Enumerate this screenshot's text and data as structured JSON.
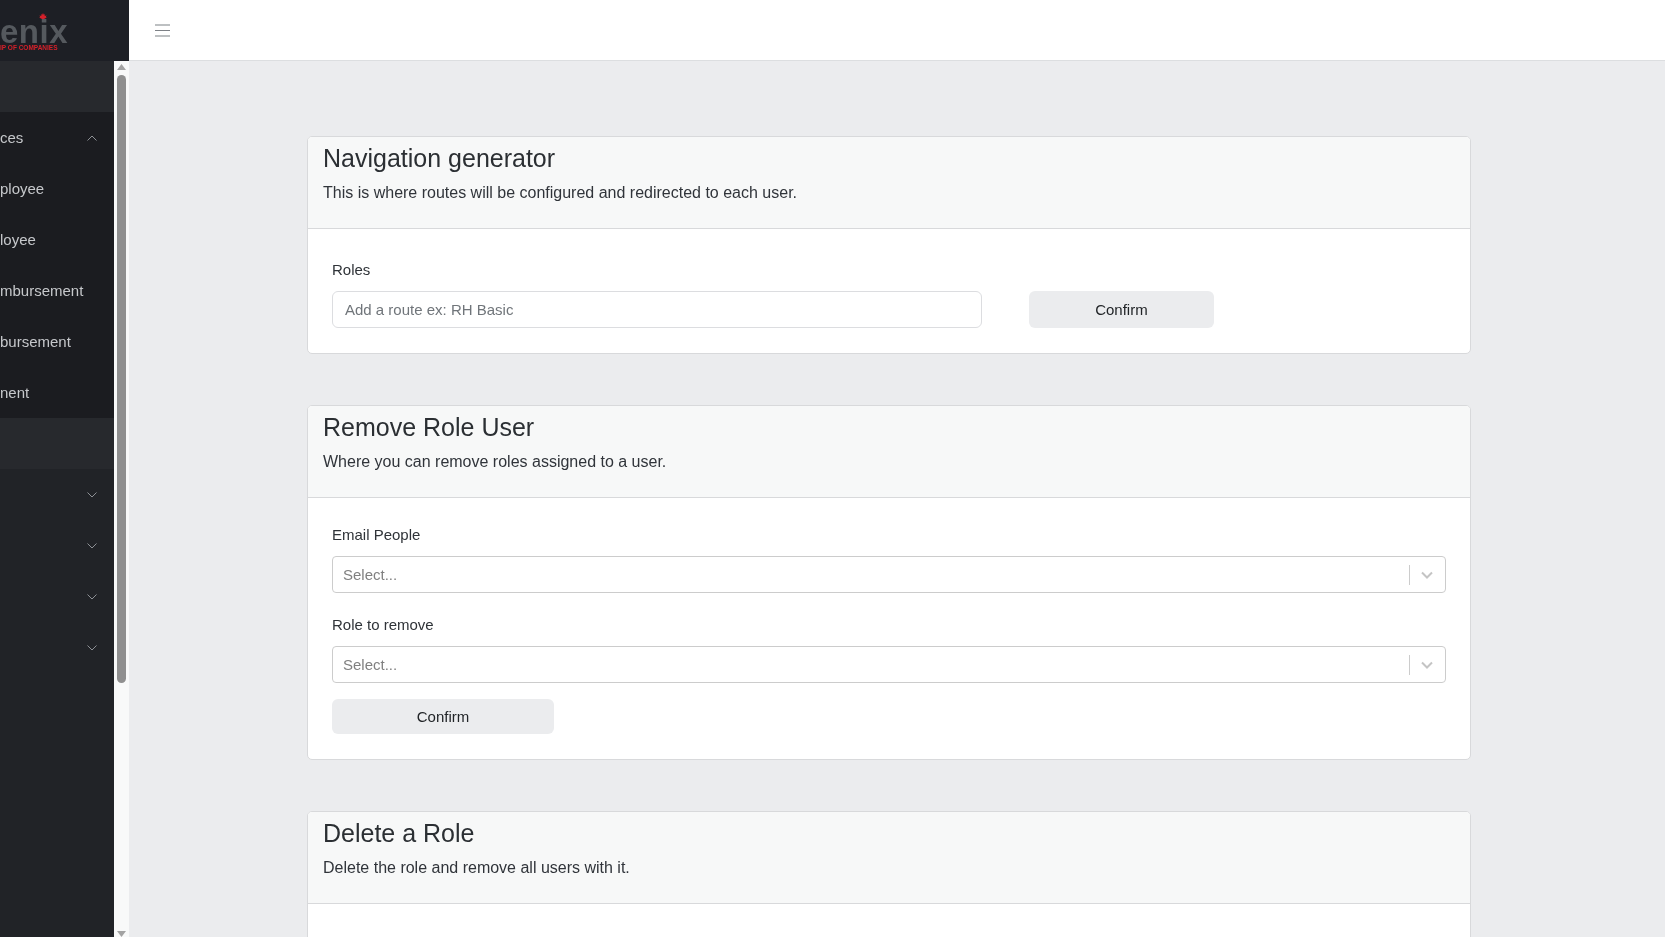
{
  "logo": {
    "name": "enix",
    "tagline": "IP OF COMPANIES"
  },
  "sidebar": {
    "groups": [
      {
        "label": "ces",
        "expanded": true,
        "children": [
          {
            "label": "ployee",
            "selected": false
          },
          {
            "label": "loyee",
            "selected": false
          },
          {
            "label": "mbursement",
            "selected": false
          },
          {
            "label": "bursement",
            "selected": false
          },
          {
            "label": "nent",
            "selected": false
          }
        ]
      },
      {
        "expanded": false
      },
      {
        "expanded": false
      },
      {
        "expanded": false
      },
      {
        "expanded": false
      }
    ]
  },
  "cards": [
    {
      "kind": "inline",
      "title": "Navigation generator",
      "subtitle": "This is where routes will be configured and redirected to each user.",
      "fields": [
        {
          "kind": "text",
          "label": "Roles",
          "placeholder": "Add a route ex: RH Basic"
        }
      ],
      "button": "Confirm"
    },
    {
      "kind": "stacked",
      "title": "Remove Role User",
      "subtitle": "Where you can remove roles assigned to a user.",
      "fields": [
        {
          "kind": "select",
          "label": "Email People",
          "placeholder": "Select..."
        },
        {
          "kind": "select",
          "label": "Role to remove",
          "placeholder": "Select..."
        }
      ],
      "button": "Confirm"
    },
    {
      "kind": "stacked",
      "title": "Delete a Role",
      "subtitle": "Delete the role and remove all users with it."
    }
  ]
}
